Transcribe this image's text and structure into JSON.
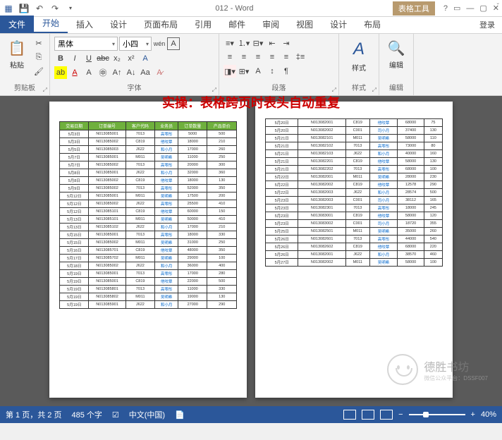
{
  "titlebar": {
    "doc_name": "012 - Word",
    "table_tools": "表格工具",
    "help": "?",
    "ribbon_toggle": "▭"
  },
  "tabs": {
    "file": "文件",
    "home": "开始",
    "insert": "插入",
    "design": "设计",
    "page_layout": "页面布局",
    "references": "引用",
    "mailings": "邮件",
    "review": "审阅",
    "view": "视图",
    "tool_design": "设计",
    "tool_layout": "布局",
    "login": "登录"
  },
  "ribbon": {
    "clipboard": {
      "label": "剪贴板",
      "paste": "粘贴"
    },
    "font": {
      "label": "字体",
      "family": "黑体",
      "size": "小四",
      "wen": "wén",
      "a_box": "A"
    },
    "paragraph": {
      "label": "段落"
    },
    "styles": {
      "label": "样式",
      "styles_btn": "样式"
    },
    "editing": {
      "label": "编辑",
      "editing_btn": "编辑"
    }
  },
  "document": {
    "title": "实操：表格跨页时表头自动重复",
    "headers": [
      "交易日期",
      "订单编号",
      "客户代码",
      "业务员",
      "订单数量",
      "产品单价"
    ],
    "page1_rows": [
      [
        "5月3日",
        "N013085001",
        "7013",
        "高零彤",
        "5000",
        "500"
      ],
      [
        "5月3日",
        "N013085002",
        "C819",
        "他咬覃",
        "18000",
        "210"
      ],
      [
        "5月5日",
        "N013085003",
        "J622",
        "和小月",
        "17000",
        "260"
      ],
      [
        "5月7日",
        "N013085001",
        "M011",
        "吴明希",
        "11000",
        "250"
      ],
      [
        "5月7日",
        "N013085002",
        "7013",
        "高零彤",
        "20000",
        "300"
      ],
      [
        "5月8日",
        "N013085001",
        "J622",
        "和小月",
        "32000",
        "360"
      ],
      [
        "5月8日",
        "N013085002",
        "C819",
        "他咬覃",
        "18000",
        "130"
      ],
      [
        "5月9日",
        "N013085002",
        "7013",
        "高零彤",
        "52000",
        "350"
      ],
      [
        "5月12日",
        "N013085001",
        "M011",
        "吴明希",
        "17500",
        "200"
      ],
      [
        "5月12日",
        "N013085002",
        "J622",
        "高零彤",
        "25500",
        "410"
      ],
      [
        "5月12日",
        "N013085101",
        "C819",
        "他咬覃",
        "60000",
        "150"
      ],
      [
        "5月13日",
        "N013085101",
        "M011",
        "吴明希",
        "50000",
        "410"
      ],
      [
        "5月13日",
        "N013085102",
        "J622",
        "和小月",
        "17000",
        "210"
      ],
      [
        "5月15日",
        "N013085001",
        "7013",
        "高零彤",
        "18000",
        "330"
      ],
      [
        "5月15日",
        "N013085002",
        "M011",
        "吴明希",
        "31000",
        "250"
      ],
      [
        "5月16日",
        "N013085701",
        "C819",
        "他咬覃",
        "48000",
        "350"
      ],
      [
        "5月17日",
        "N013085702",
        "M011",
        "吴明希",
        "29000",
        "100"
      ],
      [
        "5月18日",
        "N013085002",
        "J622",
        "和小月",
        "36000",
        "400"
      ],
      [
        "5月19日",
        "N013085001",
        "7013",
        "高零彤",
        "17000",
        "280"
      ],
      [
        "5月19日",
        "N013085001",
        "C819",
        "他咬覃",
        "22000",
        "500"
      ],
      [
        "5月19日",
        "N013085801",
        "7013",
        "高零彤",
        "11000",
        "330"
      ],
      [
        "5月19日",
        "N013085802",
        "M011",
        "吴明希",
        "19000",
        "130"
      ],
      [
        "5月19日",
        "N013085901",
        "J622",
        "和小月",
        "27000",
        "290"
      ]
    ],
    "page2_rows": [
      [
        "5月20日",
        "N013082001",
        "C819",
        "他咬覃",
        "68000",
        "75"
      ],
      [
        "5月20日",
        "N013082002",
        "C001",
        "司小月",
        "37400",
        "130"
      ],
      [
        "5月21日",
        "N013082101",
        "M011",
        "吴明希",
        "58000",
        "110"
      ],
      [
        "5月21日",
        "N013082102",
        "7013",
        "高零彤",
        "73000",
        "80"
      ],
      [
        "5月21日",
        "N013082103",
        "J622",
        "和小月",
        "40000",
        "160"
      ],
      [
        "5月21日",
        "N013082201",
        "C819",
        "他咬覃",
        "58000",
        "130"
      ],
      [
        "5月21日",
        "N013082202",
        "7013",
        "高零彤",
        "68000",
        "100"
      ],
      [
        "5月22日",
        "N013082001",
        "M011",
        "吴明希",
        "28000",
        "230"
      ],
      [
        "5月22日",
        "N013082002",
        "C819",
        "他咬覃",
        "12578",
        "290"
      ],
      [
        "5月22日",
        "N013082003",
        "J622",
        "和小月",
        "28574",
        "500"
      ],
      [
        "5月23日",
        "N013082003",
        "C001",
        "司小月",
        "38112",
        "165"
      ],
      [
        "5月23日",
        "N013082301",
        "7013",
        "高零彤",
        "18000",
        "245"
      ],
      [
        "5月23日",
        "N013083001",
        "C819",
        "他咬覃",
        "58000",
        "120"
      ],
      [
        "5月23日",
        "N013083002",
        "C001",
        "司小月",
        "18720",
        "355"
      ],
      [
        "5月25日",
        "N013082501",
        "M011",
        "吴明希",
        "35000",
        "260"
      ],
      [
        "5月26日",
        "N013082601",
        "7013",
        "高零彤",
        "44000",
        "540"
      ],
      [
        "5月26日",
        "N013082602",
        "C819",
        "他咬覃",
        "68000",
        "220"
      ],
      [
        "5月26日",
        "N013082001",
        "J622",
        "和小月",
        "38570",
        "460"
      ],
      [
        "5月27日",
        "N013082002",
        "M011",
        "吴明希",
        "58000",
        "100"
      ]
    ]
  },
  "watermark": {
    "brand": "德胜书坊",
    "sub": "微信公众平台：DSSF007"
  },
  "status": {
    "page": "第 1 页，共 2 页",
    "words": "485 个字",
    "lang": "中文(中国)",
    "zoom": "40%"
  }
}
